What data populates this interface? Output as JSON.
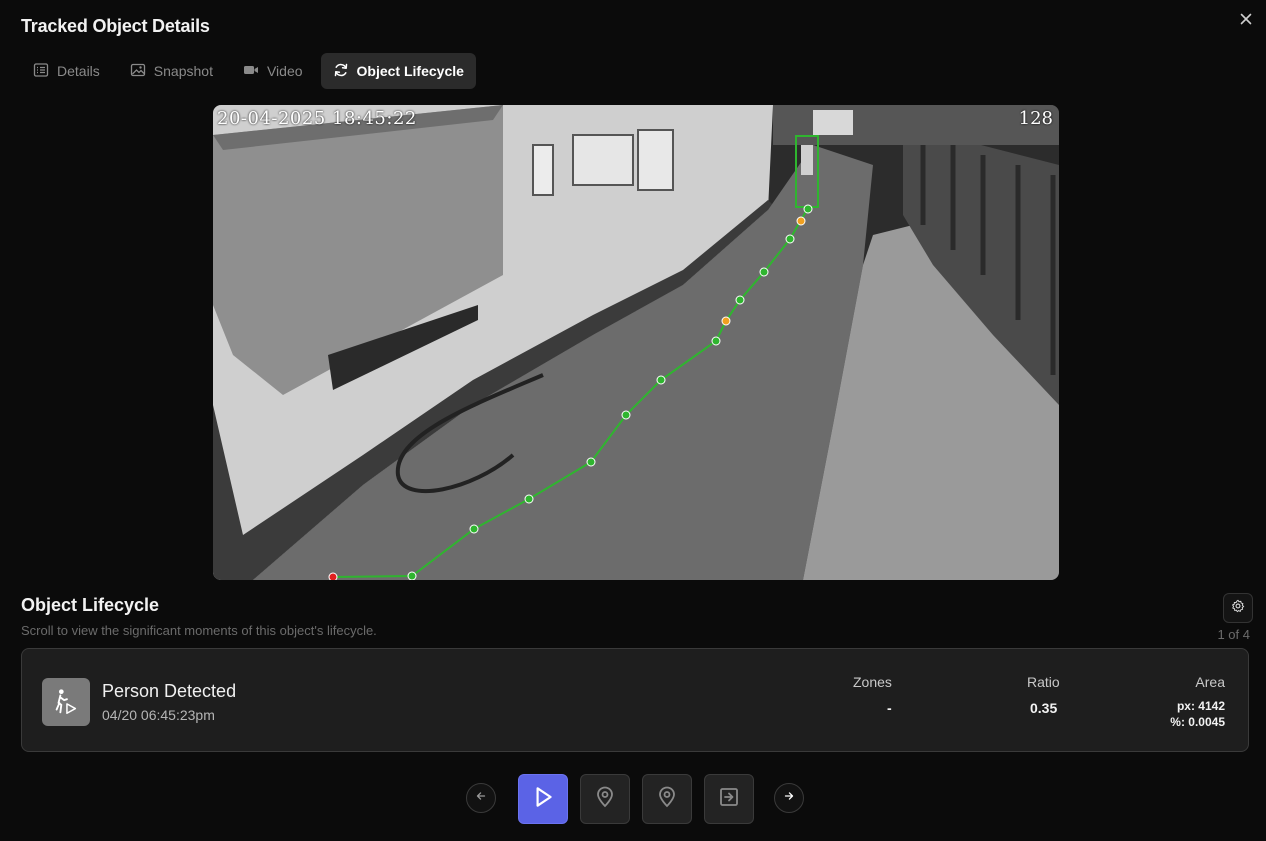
{
  "dialog": {
    "title": "Tracked Object Details",
    "close_icon": "close-icon"
  },
  "tabs": [
    {
      "label": "Details",
      "icon": "list-icon",
      "active": false
    },
    {
      "label": "Snapshot",
      "icon": "image-icon",
      "active": false
    },
    {
      "label": "Video",
      "icon": "video-icon",
      "active": false
    },
    {
      "label": "Object Lifecycle",
      "icon": "refresh-icon",
      "active": true
    }
  ],
  "camera": {
    "timestamp": "20-04-2025 18:45:22",
    "channel": "128",
    "path_color": "#2fb52f",
    "start_point_color": "#e02020",
    "highlight_point_color": "#f0a020",
    "box_color": "#2fb52f"
  },
  "lifecycle": {
    "title": "Object Lifecycle",
    "subtitle": "Scroll to view the significant moments of this object's lifecycle.",
    "pager": "1 of 4",
    "settings_icon": "gear-icon"
  },
  "event": {
    "icon": "person-walking-icon",
    "title": "Person Detected",
    "time": "04/20 06:45:23pm",
    "zones_label": "Zones",
    "zones_value": "-",
    "ratio_label": "Ratio",
    "ratio_value": "0.35",
    "area_label": "Area",
    "area_px": "px: 4142",
    "area_pct": "%: 0.0045"
  },
  "navigation": {
    "prev_icon": "arrow-left-icon",
    "next_icon": "arrow-right-icon",
    "steps": [
      {
        "icon": "play-icon",
        "active": true
      },
      {
        "icon": "map-pin-icon",
        "active": false
      },
      {
        "icon": "map-pin-icon",
        "active": false
      },
      {
        "icon": "exit-icon",
        "active": false
      }
    ],
    "accent": "#5b63e6"
  }
}
